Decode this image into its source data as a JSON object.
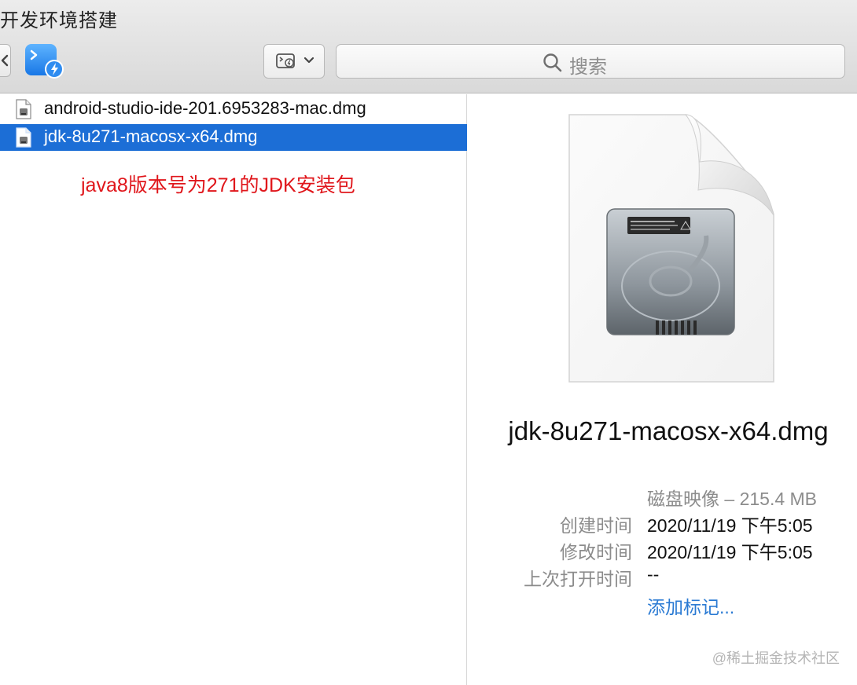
{
  "window": {
    "title": "开发环境搭建"
  },
  "toolbar": {
    "search_placeholder": "搜索",
    "icons": [
      "back-chevron-icon",
      "terminal-app-icon",
      "view-options-icon",
      "chevron-down-icon",
      "search-icon"
    ]
  },
  "files": [
    {
      "name": "android-studio-ide-201.6953283-mac.dmg",
      "selected": false,
      "icon": "dmg-file-icon"
    },
    {
      "name": "jdk-8u271-macosx-x64.dmg",
      "selected": true,
      "icon": "dmg-file-icon"
    }
  ],
  "annotation": "java8版本号为271的JDK安装包",
  "preview": {
    "name": "jdk-8u271-macosx-x64.dmg",
    "kind": "磁盘映像 – 215.4 MB",
    "created_label": "创建时间",
    "created_value": "2020/11/19 下午5:05",
    "modified_label": "修改时间",
    "modified_value": "2020/11/19 下午5:05",
    "opened_label": "上次打开时间",
    "opened_value": "--",
    "add_tags": "添加标记..."
  },
  "watermark": "@稀土掘金技术社区",
  "colors": {
    "selection": "#1c6ed6",
    "annotation": "#e0161b",
    "link": "#2a7ad3"
  }
}
